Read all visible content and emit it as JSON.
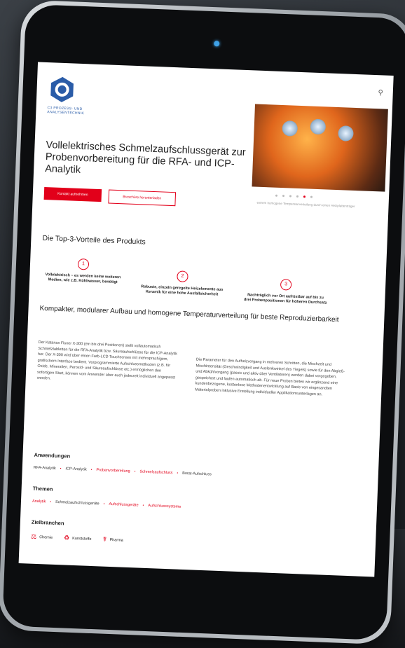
{
  "company": {
    "logo_text_line1": "C3 PROZESS- UND",
    "logo_text_line2": "ANALYSENTECHNIK"
  },
  "header": {
    "search_icon": "search-icon"
  },
  "hero": {
    "title": "Vollelektrisches Schmelzaufschlussgerät zur Probenvorbereitung für die RFA- und ICP-Analytik",
    "primary_button": "Kontakt aufnehmen",
    "secondary_button": "Broschüre herunterladen",
    "caption": "extrem homogene Temperaturverteilung durch einen Heizplattenträger"
  },
  "advantages": {
    "heading": "Die Top-3-Vorteile des Produkts",
    "items": [
      {
        "num": "1",
        "text": "Vollelektrisch – es werden keine weiteren Medien, wie z.B. Kühlwasser, benötigt"
      },
      {
        "num": "2",
        "text": "Robuste, einzeln geregelte Heizelemente aus Keramik für eine hohe Ausfallsicherheit"
      },
      {
        "num": "3",
        "text": "Nachträglich vor Ort aufrüstbar auf bis zu drei Probenpositionen für höheren Durchsatz"
      }
    ]
  },
  "details": {
    "heading": "Kompakter, modularer Aufbau und homogene Temperaturverteilung für beste Reproduzierbarkeit",
    "col1": "Der Katanax Fluxer X-300 (ein bis drei Positionen) stellt vollautomatisch Schmelztabletten für die RFA-Analytik bzw. Säureaufschlüsse für die ICP-Analytik her. Der X-300 wird über einen Farb-LCD Touchscreen mit mehrsprachigem, grafischem Interface bedient. Vorprogrammierte Aufschlussmethoden (z.B. für Oxide, Mineralien, Peroxid- und Säureaufschlüsse etc.) ermöglichen den sofortigen Start, können vom Anwender aber auch jederzeit individuell angepasst werden.",
    "col2": "Die Parameter für den Aufheizvorgang in mehreren Schritten, die Mischzeit und Mischintensität (Geschwindigkeit und Auslenkwinkel des Tiegels) sowie für den Abgieß- und Abkühlvorgang (passiv und aktiv über Ventilatoren) werden dabei vorgegeben, gespeichert und laufen automatisch ab. Für neue Proben bieten wir ergänzend eine kundenbezogene, kostenlose Methodenentwicklung auf Basis von eingesandten Materialproben inklusive Erstellung individueller Applikationsunterlagen an."
  },
  "applications": {
    "heading": "Anwendungen",
    "tags": [
      {
        "label": "RFA-Analytik",
        "red": false
      },
      {
        "label": "ICP-Analytik",
        "red": false
      },
      {
        "label": "Probenvorbereitung",
        "red": true
      },
      {
        "label": "Schmelzaufschluss",
        "red": true
      },
      {
        "label": "Borat-Aufschluss",
        "red": false
      }
    ]
  },
  "topics": {
    "heading": "Themen",
    "tags": [
      {
        "label": "Analytik",
        "red": true
      },
      {
        "label": "Schmelzaufschlussgeräte",
        "red": false
      },
      {
        "label": "Aufschlussgeräte",
        "red": true
      },
      {
        "label": "Aufschlusssysteme",
        "red": true
      }
    ]
  },
  "industries": {
    "heading": "Zielbranchen",
    "items": [
      {
        "label": "Chemie",
        "icon": "chemistry-icon"
      },
      {
        "label": "Kunststoffe",
        "icon": "plastics-icon"
      },
      {
        "label": "Pharma",
        "icon": "pharma-icon"
      }
    ]
  },
  "colors": {
    "accent": "#e2001a",
    "camera": "#3fa2e8"
  }
}
